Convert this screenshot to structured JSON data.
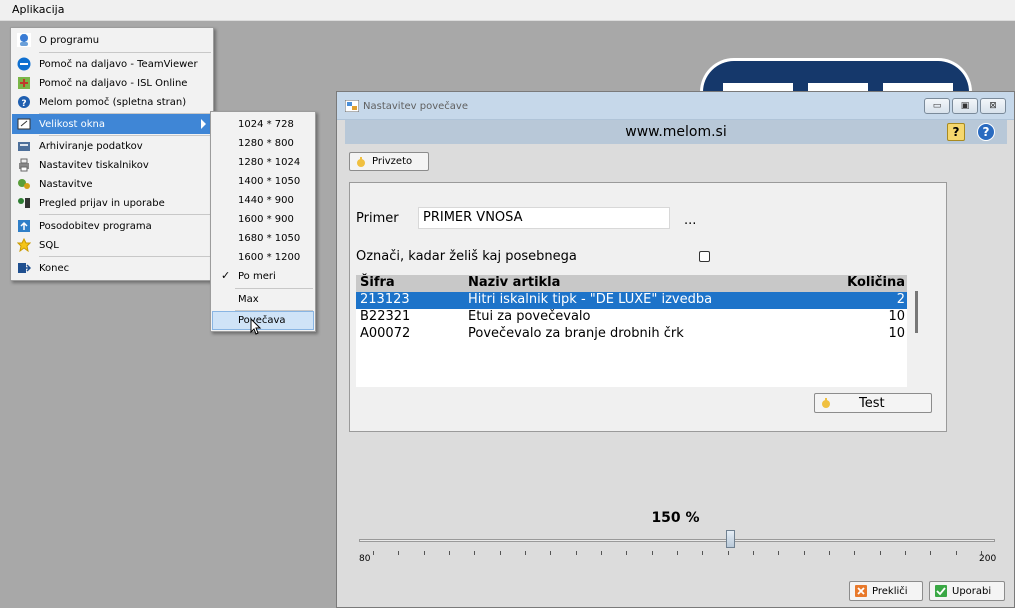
{
  "menubar": {
    "app_menu": "Aplikacija"
  },
  "menu": {
    "items": [
      {
        "label": "O programu",
        "icon": "info-user-icon"
      },
      {
        "label": "Pomoč na daljavo - TeamViewer",
        "icon": "teamviewer-icon"
      },
      {
        "label": "Pomoč na daljavo - ISL Online",
        "icon": "isl-online-icon"
      },
      {
        "label": "Melom pomoč (spletna stran)",
        "icon": "help-icon"
      },
      {
        "label": "Velikost okna",
        "icon": "window-size-icon"
      },
      {
        "label": "Arhiviranje podatkov",
        "icon": "archive-icon"
      },
      {
        "label": "Nastavitev tiskalnikov",
        "icon": "printer-icon"
      },
      {
        "label": "Nastavitve",
        "icon": "settings-icon"
      },
      {
        "label": "Pregled prijav in uporabe",
        "icon": "login-review-icon"
      },
      {
        "label": "Posodobitev programa",
        "icon": "update-icon"
      },
      {
        "label": "SQL",
        "icon": "sql-star-icon"
      },
      {
        "label": "Konec",
        "icon": "exit-icon"
      }
    ]
  },
  "submenu": {
    "items": [
      "1024 * 728",
      "1280 * 800",
      "1280 * 1024",
      "1400 * 1050",
      "1440 * 900",
      "1600 * 900",
      "1680 * 1050",
      "1600 * 1200",
      "Po meri",
      "Max",
      "Povečava"
    ],
    "checked_item": "Po meri",
    "check_mark": "✓"
  },
  "window": {
    "title": "Nastavitev povečave",
    "site": "www.melom.si",
    "help_q": "?",
    "help_btn": "?",
    "minimize": "▭",
    "maximize": "▣",
    "close": "⊠",
    "privzeto_btn": "Privzeto",
    "primer_label": "Primer",
    "primer_value": "PRIMER VNOSA",
    "ellipsis": "...",
    "checkbox_label": "Označi, kadar želiš kaj posebnega",
    "table": {
      "headers": [
        "Šifra",
        "Naziv artikla",
        "Količina"
      ],
      "rows": [
        {
          "sifra": "213123",
          "naziv": "Hitri iskalnik tipk - \"DE LUXE\" izvedba",
          "kolicina": "2"
        },
        {
          "sifra": "B22321",
          "naziv": "Etui za povečevalo",
          "kolicina": "10"
        },
        {
          "sifra": "A00072",
          "naziv": "Povečevalo za branje drobnih črk",
          "kolicina": "10"
        }
      ],
      "selected_row": 0
    },
    "test_btn": "Test",
    "zoom_label": "150 %",
    "zoom": {
      "min": 80,
      "max": 200,
      "value": 150
    },
    "min_label": "80",
    "max_label": "200",
    "cancel_btn": "Prekliči",
    "apply_btn": "Uporabi"
  },
  "colors": {
    "selection_blue": "#1d73c9",
    "menu_highlight": "#3f86d6",
    "logo_navy": "#15386b"
  }
}
